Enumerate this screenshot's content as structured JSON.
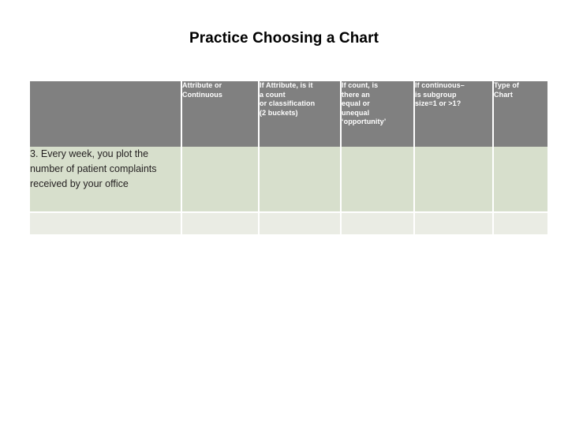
{
  "slide": {
    "title": "Practice Choosing a Chart",
    "background_color": "#ffffff"
  },
  "colors": {
    "header_fill": "#808080",
    "header_text": "#ffffff",
    "row1_fill": "#d7dfcc",
    "row2_fill": "#eaece4",
    "body_text": "#231f20",
    "gridline": "#ffffff"
  },
  "table": {
    "columns": [
      {
        "key": "scenario",
        "header": ""
      },
      {
        "key": "attribute_or_continuous",
        "header": "Attribute or\nContinuous"
      },
      {
        "key": "count_or_classification",
        "header": "If Attribute, is it\na count\nor classification\n(2 buckets)"
      },
      {
        "key": "equal_or_unequal",
        "header": "If count, is\nthere an\nequal or\nunequal\n‘opportunity’"
      },
      {
        "key": "subgroup_size",
        "header": "If continuous–\nis subgroup\nsize=1 or >1?"
      },
      {
        "key": "type_of_chart",
        "header": "Type of\nChart"
      }
    ],
    "rows": [
      {
        "scenario": "3. Every week, you plot the number of patient complaints received by your office",
        "attribute_or_continuous": "",
        "count_or_classification": "",
        "equal_or_unequal": "",
        "subgroup_size": "",
        "type_of_chart": ""
      },
      {
        "scenario": "",
        "attribute_or_continuous": "",
        "count_or_classification": "",
        "equal_or_unequal": "",
        "subgroup_size": "",
        "type_of_chart": ""
      }
    ]
  }
}
